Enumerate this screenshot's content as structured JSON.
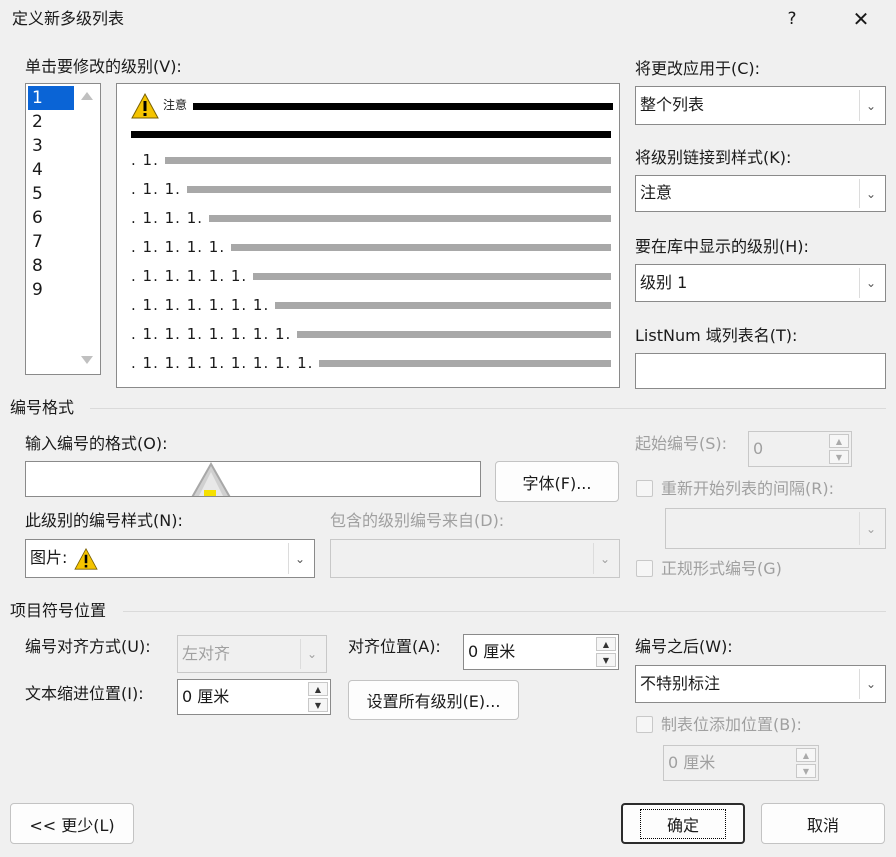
{
  "window": {
    "title": "定义新多级列表",
    "help_label": "?",
    "close_label": "✕"
  },
  "level_list": {
    "label": "单击要修改的级别(V):",
    "items": [
      "1",
      "2",
      "3",
      "4",
      "5",
      "6",
      "7",
      "8",
      "9"
    ],
    "selected": "1"
  },
  "preview": {
    "first_line_text": "注意",
    "rows": [
      ". 1.",
      ". 1. 1.",
      ". 1. 1. 1.",
      ". 1. 1. 1. 1.",
      ". 1. 1. 1. 1. 1.",
      ". 1. 1. 1. 1. 1. 1.",
      ". 1. 1. 1. 1. 1. 1. 1.",
      ". 1. 1. 1. 1. 1. 1. 1. 1."
    ]
  },
  "apply_to": {
    "label": "将更改应用于(C):",
    "value": "整个列表"
  },
  "link_style": {
    "label": "将级别链接到样式(K):",
    "value": "注意"
  },
  "gallery_level": {
    "label": "要在库中显示的级别(H):",
    "value": "级别 1"
  },
  "listnum": {
    "label": "ListNum 域列表名(T):",
    "value": ""
  },
  "number_format": {
    "group_title": "编号格式",
    "format_label": "输入编号的格式(O):",
    "format_value": "",
    "font_button": "字体(F)...",
    "style_label": "此级别的编号样式(N):",
    "style_value": "图片:",
    "include_label": "包含的级别编号来自(D):",
    "include_value": "",
    "start_label": "起始编号(S):",
    "start_value": "0",
    "restart_label": "重新开始列表的间隔(R):",
    "restart_value": "",
    "legal_label": "正规形式编号(G)"
  },
  "position": {
    "group_title": "项目符号位置",
    "align_label": "编号对齐方式(U):",
    "align_value": "左对齐",
    "align_at_label": "对齐位置(A):",
    "align_at_value": "0 厘米",
    "indent_label": "文本缩进位置(I):",
    "indent_value": "0 厘米",
    "set_all_button": "设置所有级别(E)...",
    "follow_label": "编号之后(W):",
    "follow_value": "不特别标注",
    "tab_label": "制表位添加位置(B):",
    "tab_value": "0 厘米"
  },
  "footer": {
    "less_button": "<< 更少(L)",
    "ok_button": "确定",
    "cancel_button": "取消"
  },
  "colors": {
    "selection": "#0a64d6",
    "warning_icon": "#f5c400"
  },
  "icons": {
    "preview_bullet": "warning-icon",
    "style_bullet": "warning-icon"
  }
}
